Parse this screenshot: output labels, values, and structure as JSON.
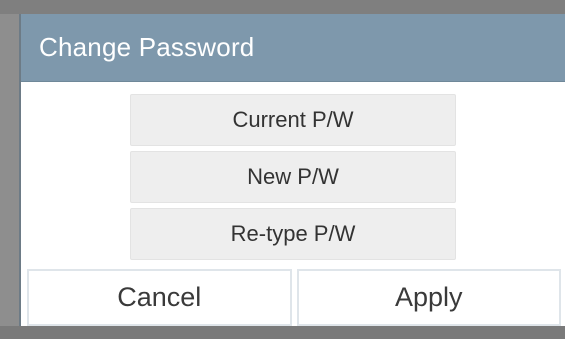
{
  "dialog": {
    "title": "Change Password",
    "fields": [
      {
        "label": "Current P/W"
      },
      {
        "label": "New P/W"
      },
      {
        "label": "Re-type P/W"
      }
    ],
    "buttons": {
      "cancel_label": "Cancel",
      "apply_label": "Apply"
    }
  },
  "colors": {
    "titlebar": "#7e98ac",
    "field_bg": "#eeeeee",
    "backdrop": "#8e8e8e"
  }
}
